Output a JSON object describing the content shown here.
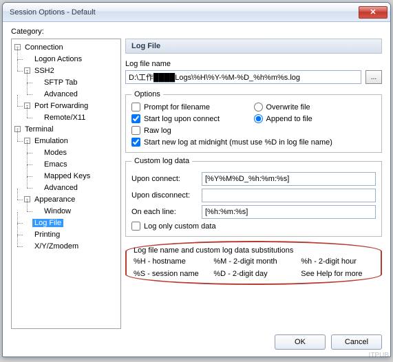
{
  "window": {
    "title": "Session Options - Default",
    "close_glyph": "✕"
  },
  "category_label": "Category:",
  "tree": {
    "connection": "Connection",
    "logon_actions": "Logon Actions",
    "ssh2": "SSH2",
    "sftp_tab": "SFTP Tab",
    "ssh2_advanced": "Advanced",
    "port_forwarding": "Port Forwarding",
    "remote_x11": "Remote/X11",
    "terminal": "Terminal",
    "emulation": "Emulation",
    "modes": "Modes",
    "emacs": "Emacs",
    "mapped_keys": "Mapped Keys",
    "emu_advanced": "Advanced",
    "appearance": "Appearance",
    "window": "Window",
    "log_file": "Log File",
    "printing": "Printing",
    "xyzmodem": "X/Y/Zmodem"
  },
  "section": {
    "header": "Log File",
    "name_label": "Log file name",
    "path_value": "D:\\工作████Logs\\%H\\%Y-%M-%D_%h%m%s.log",
    "browse_glyph": "..."
  },
  "options": {
    "legend": "Options",
    "prompt": "Prompt for filename",
    "start_on_connect": "Start log upon connect",
    "raw_log": "Raw log",
    "overwrite": "Overwrite file",
    "append": "Append to file",
    "new_at_midnight": "Start new log at midnight (must use %D in log file name)",
    "prompt_checked": false,
    "start_checked": true,
    "raw_checked": false,
    "midnight_checked": true,
    "radio_selected": "append"
  },
  "custom": {
    "legend": "Custom log data",
    "upon_connect_label": "Upon connect:",
    "upon_connect_value": "[%Y%M%D_%h:%m:%s]",
    "upon_disconnect_label": "Upon disconnect:",
    "upon_disconnect_value": "",
    "each_line_label": "On each line:",
    "each_line_value": "[%h:%m:%s]",
    "log_only_custom": "Log only custom data",
    "log_only_checked": false
  },
  "subs": {
    "title": "Log file name and custom log data substitutions",
    "h_host": "%H - hostname",
    "m_month": "%M - 2-digit month",
    "h_hour": "%h - 2-digit hour",
    "s_session": "%S - session name",
    "d_day": "%D - 2-digit day",
    "see_help": "See Help for more"
  },
  "buttons": {
    "ok": "OK",
    "cancel": "Cancel"
  },
  "watermark": "ITPUB"
}
